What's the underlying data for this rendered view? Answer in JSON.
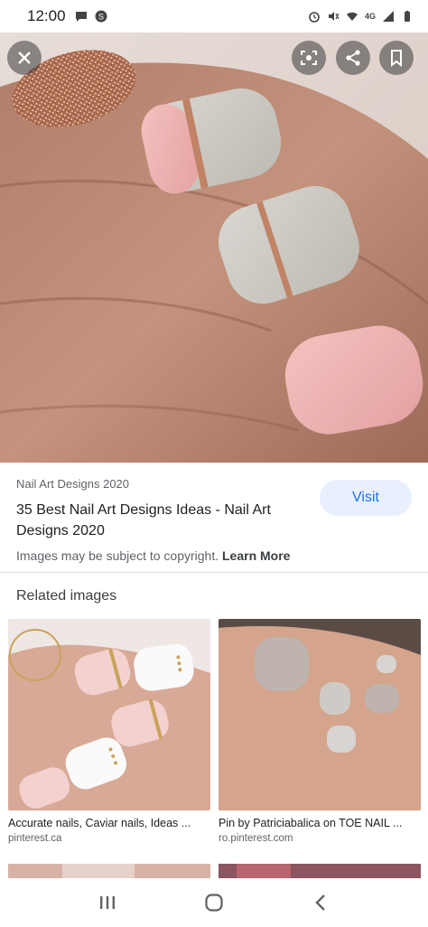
{
  "status_bar": {
    "time": "12:00",
    "left_icons": [
      "chat-icon",
      "s-circle-icon"
    ],
    "right_icons": [
      "alarm-icon",
      "mute-icon",
      "wifi-icon",
      "4g-icon",
      "signal-icon",
      "battery-icon"
    ],
    "network_label": "4G"
  },
  "viewer": {
    "close_icon": "close-icon",
    "actions": [
      "lens-icon",
      "share-icon",
      "bookmark-icon"
    ]
  },
  "result": {
    "source": "Nail Art Designs 2020",
    "title": "35 Best Nail Art Designs Ideas - Nail Art Designs 2020",
    "visit_label": "Visit",
    "copyright_text": "Images may be subject to copyright.",
    "learn_more": "Learn More"
  },
  "related": {
    "heading": "Related images",
    "items": [
      {
        "title": "Accurate nails, Caviar nails, Ideas ...",
        "source": "pinterest.ca"
      },
      {
        "title": "Pin by Patriciabalica on TOE NAIL ...",
        "source": "ro.pinterest.com"
      }
    ]
  },
  "nav_bar": {
    "buttons": [
      "recents-icon",
      "home-icon",
      "back-icon"
    ]
  },
  "colors": {
    "accent": "#1a73e8",
    "visit_bg": "#e8f0fe",
    "nail_pink": "#e8a9a8",
    "nail_grey": "#c9c7c0",
    "glitter": "#b87a5a"
  }
}
